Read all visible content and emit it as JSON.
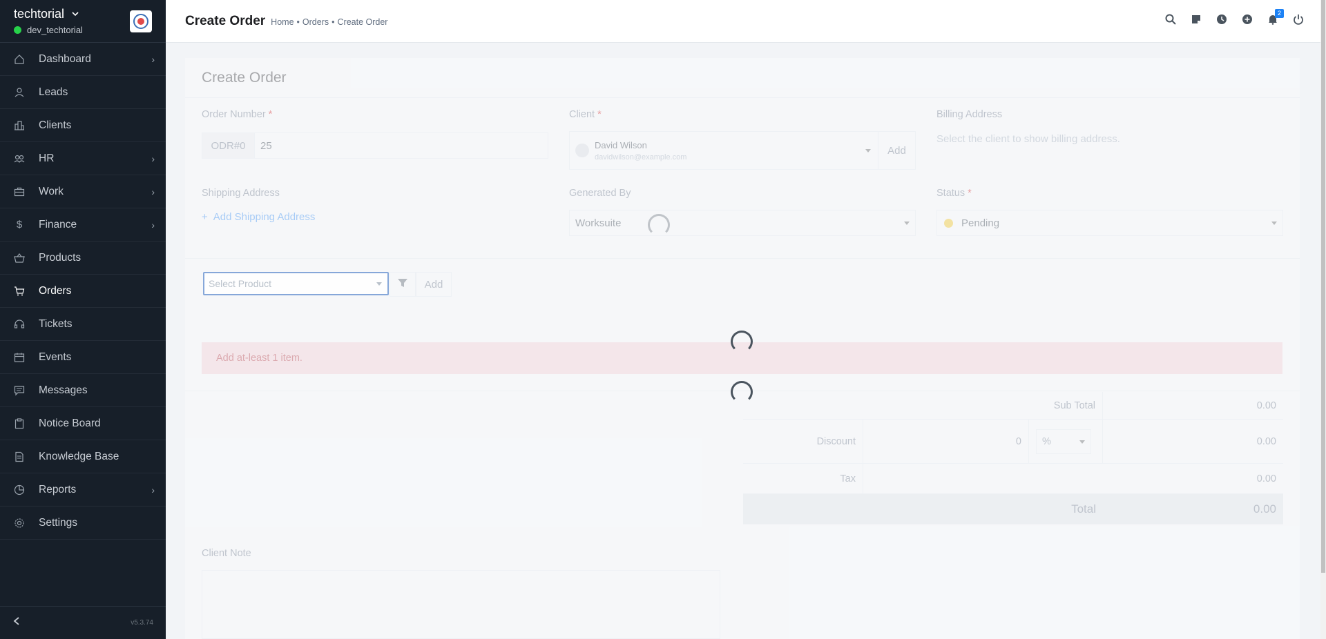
{
  "sidebar": {
    "company": "techtorial",
    "user": "dev_techtorial",
    "version": "v5.3.74",
    "items": [
      {
        "label": "Dashboard",
        "icon": "house-icon",
        "has_children": true
      },
      {
        "label": "Leads",
        "icon": "person-icon",
        "has_children": false
      },
      {
        "label": "Clients",
        "icon": "building-icon",
        "has_children": false
      },
      {
        "label": "HR",
        "icon": "people-icon",
        "has_children": true
      },
      {
        "label": "Work",
        "icon": "briefcase-icon",
        "has_children": true
      },
      {
        "label": "Finance",
        "icon": "dollar-icon",
        "has_children": true
      },
      {
        "label": "Products",
        "icon": "basket-icon",
        "has_children": false
      },
      {
        "label": "Orders",
        "icon": "cart-icon",
        "has_children": false,
        "active": true
      },
      {
        "label": "Tickets",
        "icon": "headset-icon",
        "has_children": false
      },
      {
        "label": "Events",
        "icon": "calendar-icon",
        "has_children": false
      },
      {
        "label": "Messages",
        "icon": "chat-icon",
        "has_children": false
      },
      {
        "label": "Notice Board",
        "icon": "clipboard-icon",
        "has_children": false
      },
      {
        "label": "Knowledge Base",
        "icon": "document-icon",
        "has_children": false
      },
      {
        "label": "Reports",
        "icon": "piechart-icon",
        "has_children": true
      },
      {
        "label": "Settings",
        "icon": "gear-icon",
        "has_children": false
      }
    ]
  },
  "header": {
    "title": "Create Order",
    "breadcrumb": [
      "Home",
      "•",
      "Orders",
      "•",
      "Create Order"
    ],
    "notification_count": "2"
  },
  "form": {
    "card_title": "Create Order",
    "order_number_label": "Order Number",
    "order_prefix": "ODR#0",
    "order_number_value": "25",
    "client_label": "Client",
    "client_name": "David Wilson",
    "client_email": "davidwilson@example.com",
    "client_add": "Add",
    "billing_label": "Billing Address",
    "billing_hint": "Select the client to show billing address.",
    "shipping_label": "Shipping Address",
    "add_shipping": "Add Shipping Address",
    "generated_by_label": "Generated By",
    "generated_by_value": "Worksuite",
    "status_label": "Status",
    "status_value": "Pending",
    "select_product_placeholder": "Select Product",
    "product_add": "Add",
    "alert": "Add at-least 1 item.",
    "sub_total_label": "Sub Total",
    "sub_total_value": "0.00",
    "discount_label": "Discount",
    "discount_input": "0",
    "discount_type": "%",
    "discount_value": "0.00",
    "tax_label": "Tax",
    "tax_value": "0.00",
    "total_label": "Total",
    "total_value": "0.00",
    "client_note_label": "Client Note"
  },
  "colors": {
    "sidebar_bg": "#171f29",
    "accent": "#1d82f5",
    "status_pending": "#f5c308",
    "alert_bg": "#f9cfd3"
  }
}
